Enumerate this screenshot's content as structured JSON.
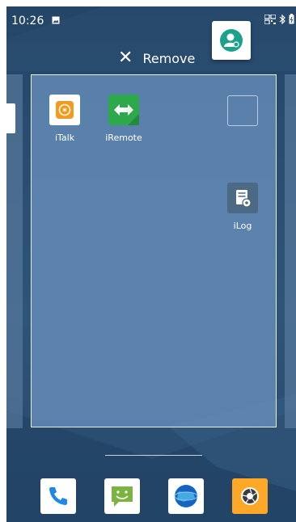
{
  "status_bar": {
    "time": "10:26",
    "left_icons": [
      "image-icon"
    ],
    "right_icons": [
      "barcode-icon",
      "bluetooth-icon",
      "battery-icon"
    ]
  },
  "remove_bar": {
    "label": "Remove",
    "icon": "close-icon"
  },
  "dragged_app": {
    "icon": "contacts-icon",
    "color": "#1aa38a"
  },
  "apps": [
    {
      "name": "iTalk",
      "icon": "italk-icon",
      "color": "#f59a1b"
    },
    {
      "name": "iRemote",
      "icon": "iremote-icon",
      "color": "#2da84a"
    },
    {
      "name": "iLog",
      "icon": "ilog-icon",
      "color": "#4d6a85"
    }
  ],
  "dock": [
    {
      "icon": "phone-icon",
      "color": "#1e88e5"
    },
    {
      "icon": "messaging-icon",
      "color": "#7cb342"
    },
    {
      "icon": "browser-icon",
      "color": "#1565c0"
    },
    {
      "icon": "camera-icon",
      "color": "#ffa726"
    }
  ]
}
